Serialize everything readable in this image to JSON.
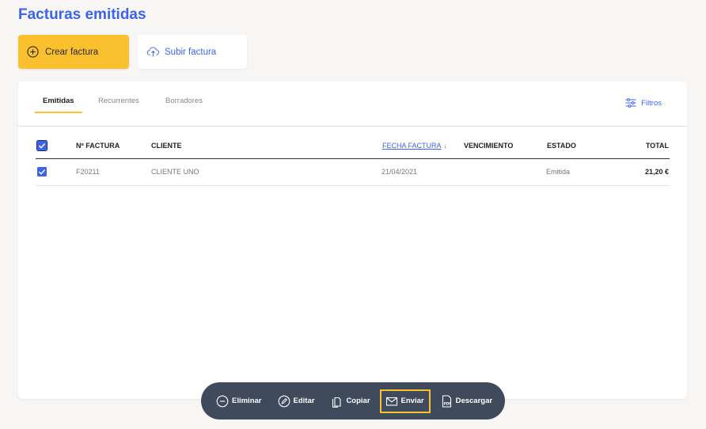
{
  "page": {
    "title": "Facturas emitidas"
  },
  "actions": {
    "create_label": "Crear factura",
    "upload_label": "Subir factura"
  },
  "tabs": [
    {
      "label": "Emitidas",
      "active": true
    },
    {
      "label": "Recurrentes",
      "active": false
    },
    {
      "label": "Borradores",
      "active": false
    }
  ],
  "filters": {
    "label": "Filtros"
  },
  "table": {
    "columns": {
      "number": "Nº FACTURA",
      "client": "CLIENTE",
      "date": "FECHA FACTURA",
      "due": "VENCIMIENTO",
      "status": "ESTADO",
      "total": "TOTAL"
    },
    "sort_arrow": "↓",
    "rows": [
      {
        "number": "F20211",
        "client": "CLIENTE UNO",
        "date": "21/04/2021",
        "due": "",
        "status": "Emitida",
        "total": "21,20 €",
        "selected": true
      }
    ]
  },
  "action_bar": {
    "delete": "Eliminar",
    "edit": "Editar",
    "copy": "Copiar",
    "send": "Enviar",
    "download": "Descargar"
  },
  "colors": {
    "accent": "#3d63ea",
    "primary_button": "#fbc02d",
    "action_bar": "#3f4b5c",
    "focus": "#fbc02d"
  },
  "icons": [
    "plus-circle-icon",
    "cloud-upload-icon",
    "filter-sliders-icon",
    "check-icon",
    "minus-circle-icon",
    "pencil-icon",
    "copy-icon",
    "envelope-icon",
    "pdf-file-icon"
  ]
}
